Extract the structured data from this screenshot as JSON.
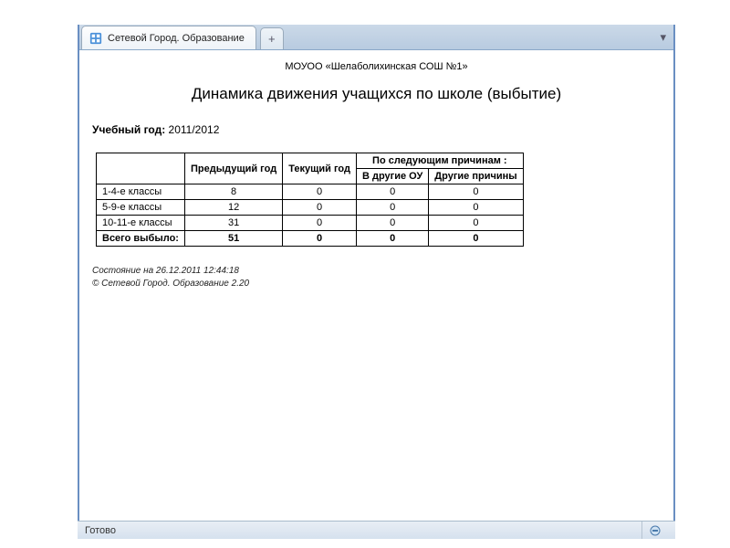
{
  "browser": {
    "tab_title": "Сетевой Город. Образование",
    "new_tab_glyph": "+",
    "tab_overflow_glyph": "▾"
  },
  "content": {
    "org": "МОУОО «Шелаболихинская СОШ №1»",
    "title": "Динамика движения учащихся по школе (выбытие)",
    "year_label": "Учебный год:",
    "year_value": "2011/2012"
  },
  "chart_data": {
    "type": "table",
    "headers": {
      "col_prev": "Предыдущий год",
      "col_curr": "Текущий год",
      "reasons_group": "По следующим причинам :",
      "reason_other_school": "В другие ОУ",
      "reason_other": "Другие причины"
    },
    "rows": [
      {
        "label": "1-4-е классы",
        "prev": 8,
        "curr": 0,
        "other_school": 0,
        "other_reason": 0
      },
      {
        "label": "5-9-е классы",
        "prev": 12,
        "curr": 0,
        "other_school": 0,
        "other_reason": 0
      },
      {
        "label": "10-11-е классы",
        "prev": 31,
        "curr": 0,
        "other_school": 0,
        "other_reason": 0
      }
    ],
    "total": {
      "label": "Всего выбыло:",
      "prev": 51,
      "curr": 0,
      "other_school": 0,
      "other_reason": 0
    }
  },
  "footer": {
    "state_line": "Состояние на 26.12.2011 12:44:18",
    "copyright": "© Сетевой Город. Образование 2.20"
  },
  "status": {
    "text": "Готово"
  }
}
